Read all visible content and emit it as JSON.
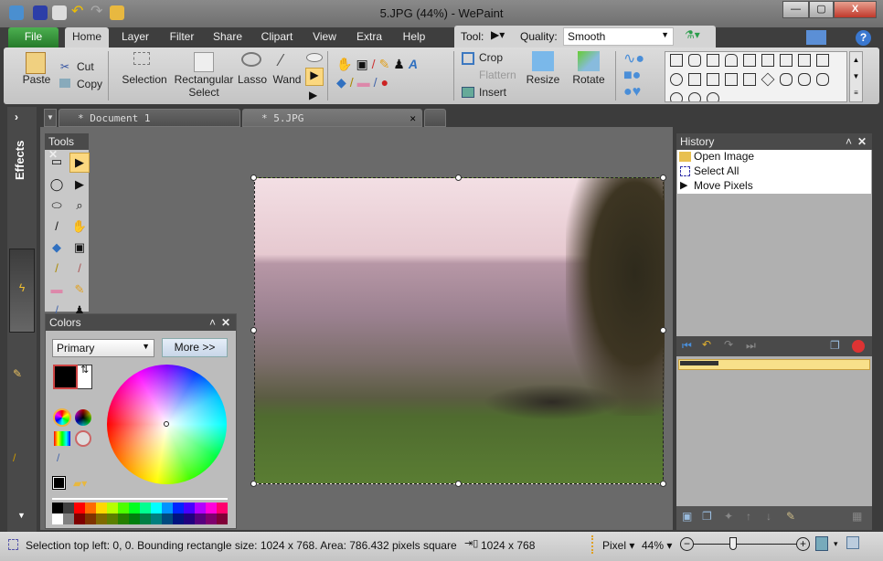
{
  "window": {
    "title": "5.JPG (44%) - WePaint",
    "min": "—",
    "max": "▢",
    "close": "X"
  },
  "menu": {
    "tabs": [
      "File",
      "Home",
      "Layer",
      "Filter",
      "Share",
      "Clipart",
      "View",
      "Extra",
      "Help"
    ],
    "active": "Home"
  },
  "ribbon": {
    "paste": "Paste",
    "cut": "Cut",
    "copy": "Copy",
    "selection": "Selection",
    "rect1": "Rectangular",
    "rect2": "Select",
    "lasso": "Lasso",
    "wand": "Wand",
    "crop": "Crop",
    "flatten": "Flattern",
    "insert": "Insert",
    "resize": "Resize",
    "rotate": "Rotate"
  },
  "tool_options": {
    "tool_label": "Tool:",
    "quality_label": "Quality:",
    "quality_value": "Smooth"
  },
  "sidebar": {
    "effects": "Effects"
  },
  "documents": [
    {
      "label": "* Document 1"
    },
    {
      "label": "* 5.JPG",
      "close": "✕"
    }
  ],
  "tools_panel": {
    "title": "Tools",
    "close": "✕"
  },
  "colors_panel": {
    "title": "Colors",
    "mode": "Primary",
    "more": "More >>",
    "primary": "#000000",
    "secondary": "#ffffff",
    "palette_top": [
      "#000000",
      "#404040",
      "#ff0000",
      "#ff6a00",
      "#ffd800",
      "#b6ff00",
      "#4cff00",
      "#00ff21",
      "#00ff90",
      "#00ffff",
      "#0094ff",
      "#0026ff",
      "#4800ff",
      "#b200ff",
      "#ff00dc",
      "#ff006e"
    ],
    "palette_bottom": [
      "#ffffff",
      "#808080",
      "#7f0000",
      "#7f3300",
      "#7f6a00",
      "#5b7f00",
      "#267f00",
      "#007f0e",
      "#007f46",
      "#007f7f",
      "#004a7f",
      "#00137f",
      "#21007f",
      "#57007f",
      "#7f006e",
      "#7f0037"
    ]
  },
  "history": {
    "title": "History",
    "items": [
      "Open Image",
      "Select All",
      "Move Pixels"
    ]
  },
  "status": {
    "message": "Selection top left: 0, 0. Bounding rectangle size: 1024 x 768. Area: 786.432 pixels square",
    "image_size": "1024 x 768",
    "unit": "Pixel",
    "zoom": "44%",
    "zoom_level": 0.44
  }
}
